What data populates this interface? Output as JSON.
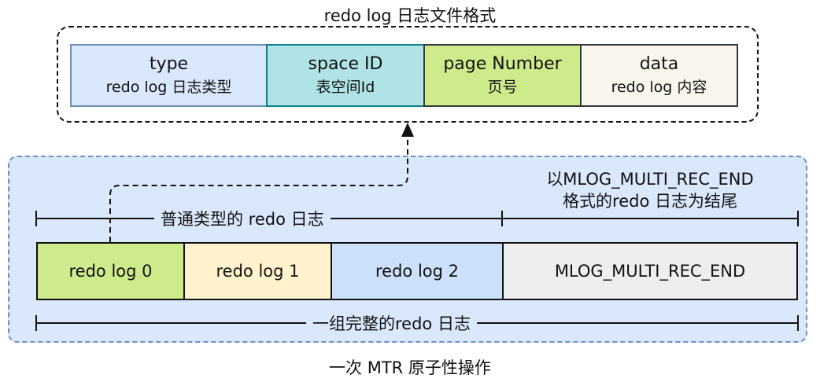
{
  "format_title": "redo log 日志文件格式",
  "format_fields": [
    {
      "name": "type",
      "desc": "redo log 日志类型",
      "color": "#dae8fc",
      "border": "#6c8ebf"
    },
    {
      "name": "space ID",
      "desc": "表空间Id",
      "color": "#b0e3e6",
      "border": "#0e8088"
    },
    {
      "name": "page Number",
      "desc": "页号",
      "color": "#cdeb8b",
      "border": "#36393d"
    },
    {
      "name": "data",
      "desc": "redo log 内容",
      "color": "#f9f7ed",
      "border": "#36393d"
    }
  ],
  "mtr": {
    "normal_label": "普通类型的 redo 日志",
    "end_label_line1": "以MLOG_MULTI_REC_END",
    "end_label_line2": "格式的redo 日志为结尾",
    "logs": [
      {
        "label": "redo log 0",
        "color": "#cdeb8b"
      },
      {
        "label": "redo log 1",
        "color": "#fff2cc"
      },
      {
        "label": "redo log 2",
        "color": "#cce0fa"
      },
      {
        "label": "MLOG_MULTI_REC_END",
        "color": "#eeeeee"
      }
    ],
    "group_label": "一组完整的redo 日志",
    "caption": "一次 MTR 原子性操作"
  }
}
